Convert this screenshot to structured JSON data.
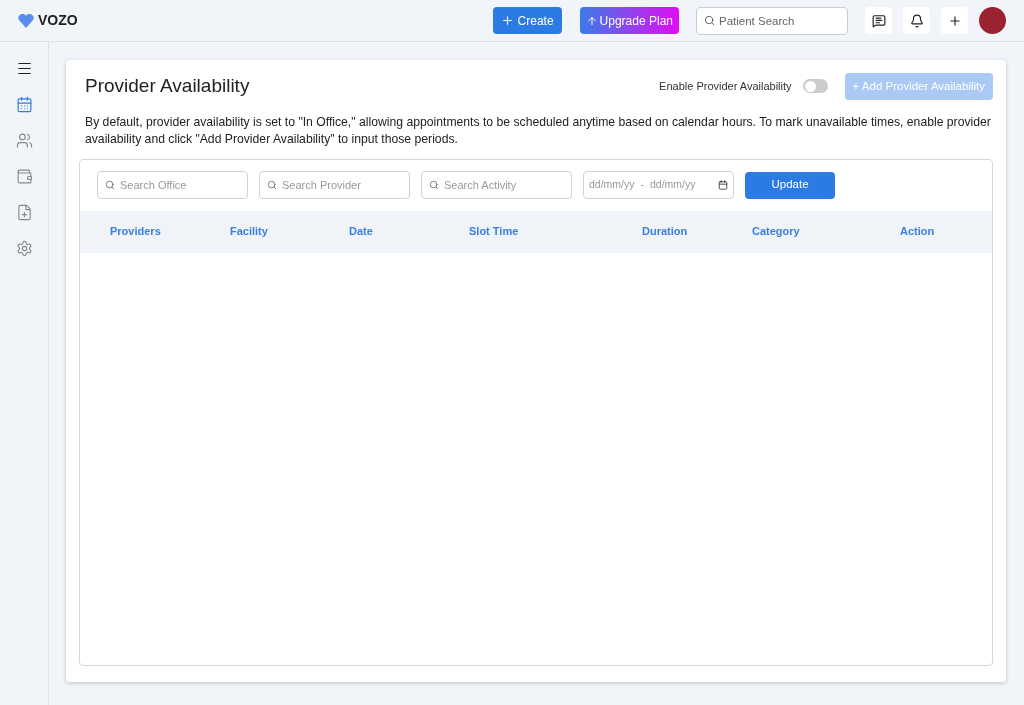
{
  "header": {
    "logo": "VOZO",
    "create_button": "Create",
    "upgrade_button": "Upgrade Plan",
    "search": {
      "placeholder": "Patient Search"
    },
    "actions": [
      {
        "kind": "messages"
      },
      {
        "kind": "notifications"
      },
      {
        "kind": "add"
      }
    ]
  },
  "sidebar": {
    "items": [
      {
        "kind": "menu",
        "selected": false
      },
      {
        "kind": "calendar",
        "selected": true
      },
      {
        "kind": "users",
        "selected": false
      },
      {
        "kind": "wallet",
        "selected": false
      },
      {
        "kind": "document",
        "selected": false
      },
      {
        "kind": "settings",
        "selected": false
      }
    ]
  },
  "page": {
    "title": "Provider Availability",
    "toggle": {
      "label": "Enable Provider Availability",
      "on": false
    },
    "add_button": {
      "label": "+ Add Provider Availability",
      "disabled": true
    },
    "description": "By default, provider availability is set to \"In Office,\" allowing appointments to be scheduled anytime based on calendar hours. To mark unavailable times, enable provider availability and click \"Add Provider Availability\" to input those periods."
  },
  "filters": {
    "search_fields": [
      {
        "placeholder": "Search Office"
      },
      {
        "placeholder": "Search Provider"
      },
      {
        "placeholder": "Search Activity"
      }
    ],
    "date_range": {
      "start_placeholder": "dd/mm/yy",
      "separator": "-",
      "end_placeholder": "dd/mm/yy"
    },
    "update_button": "Update"
  },
  "table": {
    "columns": [
      "Providers",
      "Facility",
      "Date",
      "Slot Time",
      "Duration",
      "Category",
      "Action"
    ]
  }
}
